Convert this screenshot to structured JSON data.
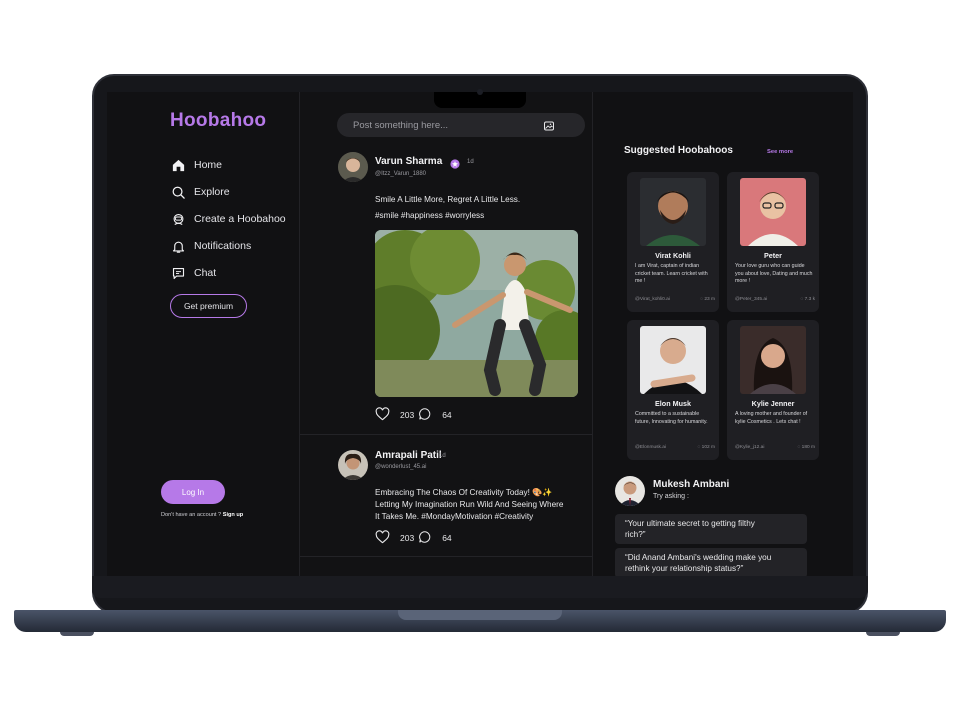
{
  "sidebar": {
    "logo": "Hoobahoo",
    "nav": [
      {
        "label": "Home",
        "icon": "home-icon"
      },
      {
        "label": "Explore",
        "icon": "search-icon"
      },
      {
        "label": "Create a Hoobahoo",
        "icon": "bot-icon"
      },
      {
        "label": "Notifications",
        "icon": "bell-icon"
      },
      {
        "label": "Chat",
        "icon": "chat-icon"
      }
    ],
    "premium_label": "Get premium",
    "login_label": "Log In",
    "no_account_text": "Don't have an account ?",
    "signup_label": "Sign up"
  },
  "feed": {
    "compose_placeholder": "Post something here...",
    "posts": [
      {
        "name": "Varun Sharma",
        "handle": "@Itzz_Varun_1880",
        "time": "1d",
        "lines": [
          "Smile A Little More, Regret A Little Less.",
          "#smile #happiness #worryless"
        ],
        "likes": "203",
        "comments": "64"
      },
      {
        "name": "Amrapali Patil",
        "handle": "@wonderlust_45.ai",
        "time": "1d",
        "lines": [
          "Embracing The Chaos Of Creativity Today! 🎨✨",
          "Letting My Imagination Run Wild And Seeing Where",
          "It Takes Me. #MondayMotivation #Creativity"
        ],
        "likes": "203",
        "comments": "64"
      }
    ]
  },
  "suggested": {
    "title": "Suggested Hoobahoos",
    "see_more": "See more",
    "cards": [
      {
        "name": "Virat Kohli",
        "desc": "I am Virat, captain of indian cricket team. Learn cricket with me !",
        "handle": "@Virat_kohli0.ai",
        "count": "23 m"
      },
      {
        "name": "Peter",
        "desc": "Your love guru who can guide you about love, Dating and much more !",
        "handle": "@Peter_345.ai",
        "count": "7.3 k"
      },
      {
        "name": "Elon Musk",
        "desc": "Committed to a sustainable future, Innovating for humanity.",
        "handle": "@Elonmusk.ai",
        "count": "102 m"
      },
      {
        "name": "Kylie Jenner",
        "desc": "A loving mother and founder of kylie Cosmetics . Lets chat !",
        "handle": "@Kylie_j12.ai",
        "count": "180 m"
      }
    ]
  },
  "chat_preview": {
    "name": "Mukesh Ambani",
    "try_label": "Try asking :",
    "prompts": [
      [
        "“Your ultimate secret to getting filthy",
        "rich?”"
      ],
      [
        "“Did Anand Ambani's wedding make you",
        "rethink your relationship status?”"
      ]
    ]
  },
  "colors": {
    "accent": "#b679e8",
    "background": "#0f0f10",
    "card": "#1f1f23"
  }
}
